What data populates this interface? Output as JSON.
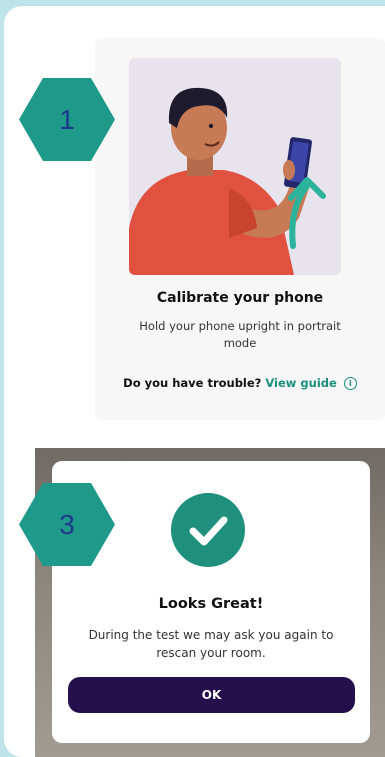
{
  "step1": {
    "badge": "1",
    "title": "Calibrate your phone",
    "subtitle": "Hold your phone upright in portrait mode",
    "trouble_prefix": "Do you have trouble?",
    "guide_link": "View guide",
    "info_glyph": "i",
    "illustration": "person-holding-phone-upright",
    "arrow_icon": "arrow-up-icon"
  },
  "step3": {
    "badge": "3",
    "icon": "check-icon",
    "title": "Looks Great!",
    "message": "During the test we may ask you again to rescan your room.",
    "ok_label": "OK"
  },
  "colors": {
    "accent_teal": "#1f9a8a",
    "badge_text": "#1d3a8a",
    "button_dark": "#25104d",
    "page_border": "#bfe3ea"
  }
}
